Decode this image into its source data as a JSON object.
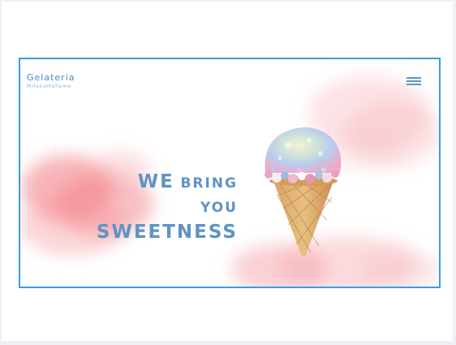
{
  "brand": {
    "name": "Gelateria",
    "tagline": "MilanoHoFame"
  },
  "menu": {
    "icon": "hamburger-menu-icon"
  },
  "hero": {
    "line1_big": "WE",
    "line1_small": "BRING",
    "line2": "YOU",
    "line3": "SWEETNESS"
  },
  "colors": {
    "frame_border": "#3a9ee0",
    "headline": "#5e93c6",
    "cloud": "#f27880"
  }
}
